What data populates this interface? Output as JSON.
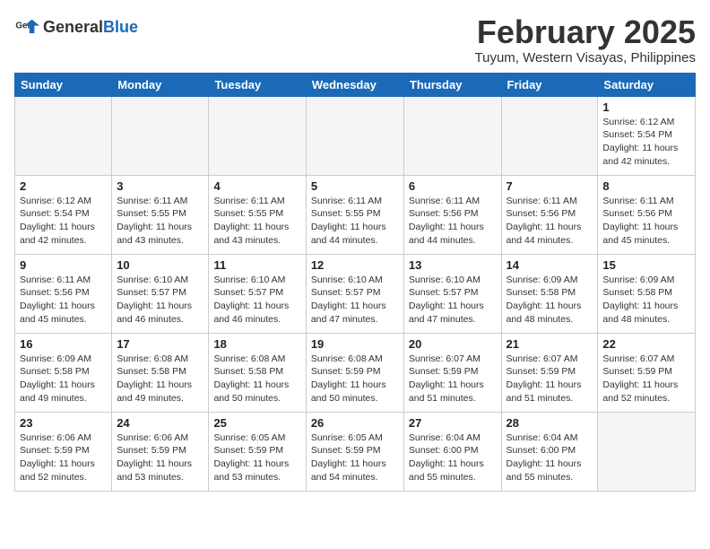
{
  "header": {
    "logo_general": "General",
    "logo_blue": "Blue",
    "month_title": "February 2025",
    "location": "Tuyum, Western Visayas, Philippines"
  },
  "days_of_week": [
    "Sunday",
    "Monday",
    "Tuesday",
    "Wednesday",
    "Thursday",
    "Friday",
    "Saturday"
  ],
  "weeks": [
    [
      {
        "day": "",
        "empty": true
      },
      {
        "day": "",
        "empty": true
      },
      {
        "day": "",
        "empty": true
      },
      {
        "day": "",
        "empty": true
      },
      {
        "day": "",
        "empty": true
      },
      {
        "day": "",
        "empty": true
      },
      {
        "day": "1",
        "sunrise": "6:12 AM",
        "sunset": "5:54 PM",
        "daylight": "11 hours and 42 minutes."
      }
    ],
    [
      {
        "day": "2",
        "sunrise": "6:12 AM",
        "sunset": "5:54 PM",
        "daylight": "11 hours and 42 minutes."
      },
      {
        "day": "3",
        "sunrise": "6:11 AM",
        "sunset": "5:55 PM",
        "daylight": "11 hours and 43 minutes."
      },
      {
        "day": "4",
        "sunrise": "6:11 AM",
        "sunset": "5:55 PM",
        "daylight": "11 hours and 43 minutes."
      },
      {
        "day": "5",
        "sunrise": "6:11 AM",
        "sunset": "5:55 PM",
        "daylight": "11 hours and 44 minutes."
      },
      {
        "day": "6",
        "sunrise": "6:11 AM",
        "sunset": "5:56 PM",
        "daylight": "11 hours and 44 minutes."
      },
      {
        "day": "7",
        "sunrise": "6:11 AM",
        "sunset": "5:56 PM",
        "daylight": "11 hours and 44 minutes."
      },
      {
        "day": "8",
        "sunrise": "6:11 AM",
        "sunset": "5:56 PM",
        "daylight": "11 hours and 45 minutes."
      }
    ],
    [
      {
        "day": "9",
        "sunrise": "6:11 AM",
        "sunset": "5:56 PM",
        "daylight": "11 hours and 45 minutes."
      },
      {
        "day": "10",
        "sunrise": "6:10 AM",
        "sunset": "5:57 PM",
        "daylight": "11 hours and 46 minutes."
      },
      {
        "day": "11",
        "sunrise": "6:10 AM",
        "sunset": "5:57 PM",
        "daylight": "11 hours and 46 minutes."
      },
      {
        "day": "12",
        "sunrise": "6:10 AM",
        "sunset": "5:57 PM",
        "daylight": "11 hours and 47 minutes."
      },
      {
        "day": "13",
        "sunrise": "6:10 AM",
        "sunset": "5:57 PM",
        "daylight": "11 hours and 47 minutes."
      },
      {
        "day": "14",
        "sunrise": "6:09 AM",
        "sunset": "5:58 PM",
        "daylight": "11 hours and 48 minutes."
      },
      {
        "day": "15",
        "sunrise": "6:09 AM",
        "sunset": "5:58 PM",
        "daylight": "11 hours and 48 minutes."
      }
    ],
    [
      {
        "day": "16",
        "sunrise": "6:09 AM",
        "sunset": "5:58 PM",
        "daylight": "11 hours and 49 minutes."
      },
      {
        "day": "17",
        "sunrise": "6:08 AM",
        "sunset": "5:58 PM",
        "daylight": "11 hours and 49 minutes."
      },
      {
        "day": "18",
        "sunrise": "6:08 AM",
        "sunset": "5:58 PM",
        "daylight": "11 hours and 50 minutes."
      },
      {
        "day": "19",
        "sunrise": "6:08 AM",
        "sunset": "5:59 PM",
        "daylight": "11 hours and 50 minutes."
      },
      {
        "day": "20",
        "sunrise": "6:07 AM",
        "sunset": "5:59 PM",
        "daylight": "11 hours and 51 minutes."
      },
      {
        "day": "21",
        "sunrise": "6:07 AM",
        "sunset": "5:59 PM",
        "daylight": "11 hours and 51 minutes."
      },
      {
        "day": "22",
        "sunrise": "6:07 AM",
        "sunset": "5:59 PM",
        "daylight": "11 hours and 52 minutes."
      }
    ],
    [
      {
        "day": "23",
        "sunrise": "6:06 AM",
        "sunset": "5:59 PM",
        "daylight": "11 hours and 52 minutes."
      },
      {
        "day": "24",
        "sunrise": "6:06 AM",
        "sunset": "5:59 PM",
        "daylight": "11 hours and 53 minutes."
      },
      {
        "day": "25",
        "sunrise": "6:05 AM",
        "sunset": "5:59 PM",
        "daylight": "11 hours and 53 minutes."
      },
      {
        "day": "26",
        "sunrise": "6:05 AM",
        "sunset": "5:59 PM",
        "daylight": "11 hours and 54 minutes."
      },
      {
        "day": "27",
        "sunrise": "6:04 AM",
        "sunset": "6:00 PM",
        "daylight": "11 hours and 55 minutes."
      },
      {
        "day": "28",
        "sunrise": "6:04 AM",
        "sunset": "6:00 PM",
        "daylight": "11 hours and 55 minutes."
      },
      {
        "day": "",
        "empty": true
      }
    ]
  ]
}
